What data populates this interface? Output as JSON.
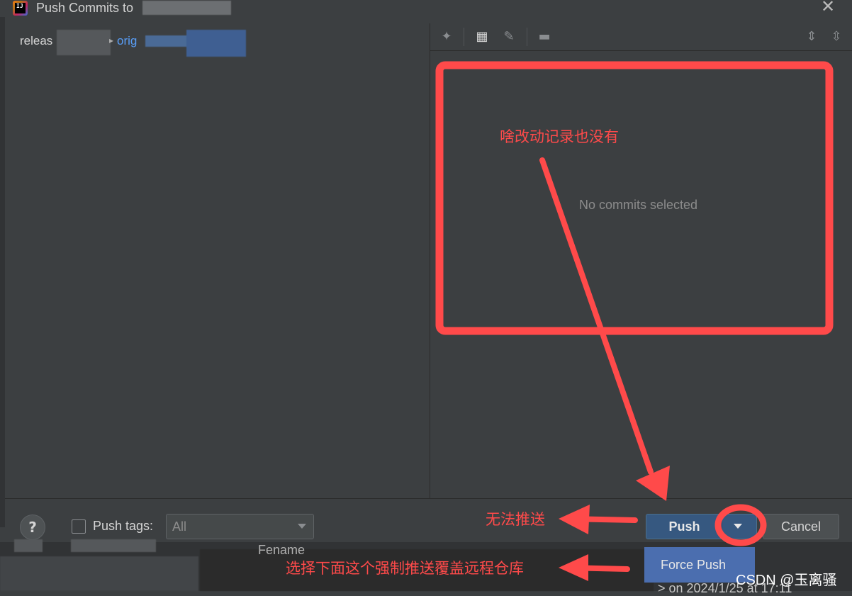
{
  "window": {
    "title": "Push Commits to",
    "app_icon_label": "IJ"
  },
  "left_panel": {
    "branch_text": "releas",
    "remote_text": "orig"
  },
  "toolbar": {
    "icons": [
      "collapse-icon",
      "group-icon",
      "edit-icon",
      "preview-icon",
      "expand-all-icon",
      "collapse-all-icon"
    ]
  },
  "details": {
    "empty_message": "No commits selected"
  },
  "footer": {
    "help_label": "?",
    "push_tags_label": "Push tags:",
    "tags_combo_value": "All",
    "push_label": "Push",
    "cancel_label": "Cancel"
  },
  "dropdown_menu": {
    "force_push_label": "Force Push"
  },
  "background": {
    "fename_text": "Fename",
    "date_text": "> on 2024/1/25 at 17:11"
  },
  "annotations": {
    "box_note": "啥改动记录也没有",
    "push_note": "无法推送",
    "force_note": "选择下面这个强制推送覆盖远程仓库",
    "color": "#ff4a4a"
  },
  "watermark": "CSDN @玉离骚"
}
